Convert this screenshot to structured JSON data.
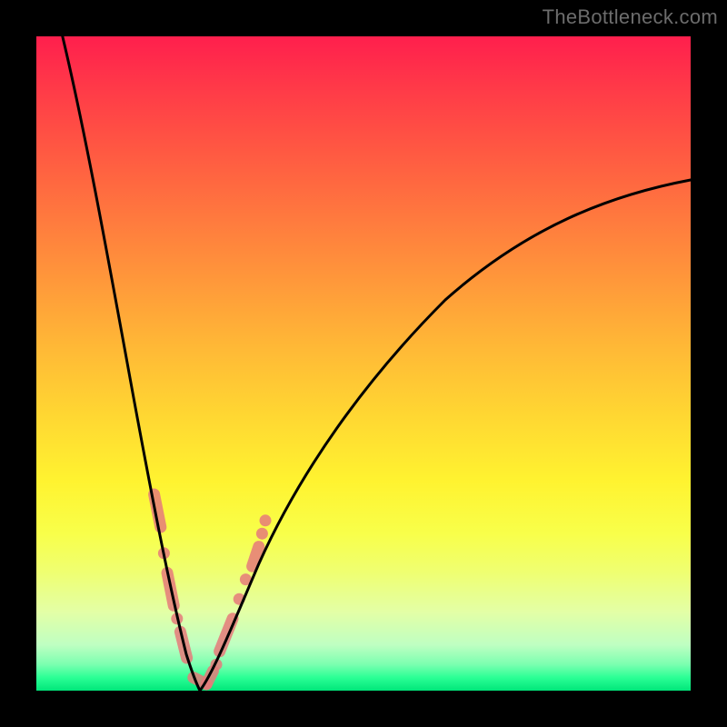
{
  "watermark": "TheBottleneck.com",
  "colors": {
    "curve": "#000000",
    "marker": "#e57a7a",
    "background_top": "#ff1f4d",
    "background_bottom": "#00e67a",
    "frame": "#000000"
  },
  "chart_data": {
    "type": "line",
    "title": "",
    "xlabel": "",
    "ylabel": "",
    "xlim": [
      0,
      100
    ],
    "ylim": [
      0,
      100
    ],
    "grid": false,
    "legend": false,
    "background": "vertical gradient red→orange→yellow→green (bottleneck heat scale)",
    "description": "Two-sided bottleneck V-curve: steep left descending branch and shallower right ascending branch meeting near zero at the valley.",
    "series": [
      {
        "name": "left_branch",
        "x": [
          4,
          8,
          12,
          15,
          18,
          20,
          22,
          24,
          25
        ],
        "y": [
          100,
          82,
          62,
          44,
          27,
          16,
          8,
          2,
          0
        ]
      },
      {
        "name": "right_branch",
        "x": [
          25,
          28,
          32,
          38,
          46,
          56,
          68,
          82,
          100
        ],
        "y": [
          0,
          6,
          14,
          26,
          40,
          53,
          64,
          72,
          78
        ]
      }
    ],
    "annotations": {
      "valley_markers": {
        "note": "pink capsule segments and dots overlaid on curve near valley, approximate x,y positions on 0–100 scale",
        "segments": [
          {
            "x1": 18,
            "y1": 30,
            "x2": 19,
            "y2": 25
          },
          {
            "x1": 20,
            "y1": 18,
            "x2": 21,
            "y2": 13
          },
          {
            "x1": 22,
            "y1": 9,
            "x2": 23,
            "y2": 5
          },
          {
            "x1": 24,
            "y1": 2,
            "x2": 26,
            "y2": 1
          },
          {
            "x1": 26,
            "y1": 1,
            "x2": 27,
            "y2": 3
          },
          {
            "x1": 28,
            "y1": 6,
            "x2": 30,
            "y2": 11
          },
          {
            "x1": 33,
            "y1": 19,
            "x2": 34,
            "y2": 22
          }
        ],
        "dots": [
          {
            "x": 19.5,
            "y": 21
          },
          {
            "x": 21.5,
            "y": 11
          },
          {
            "x": 27.5,
            "y": 4
          },
          {
            "x": 31,
            "y": 14
          },
          {
            "x": 32,
            "y": 17
          },
          {
            "x": 34.5,
            "y": 24
          },
          {
            "x": 35,
            "y": 26
          }
        ]
      }
    }
  }
}
